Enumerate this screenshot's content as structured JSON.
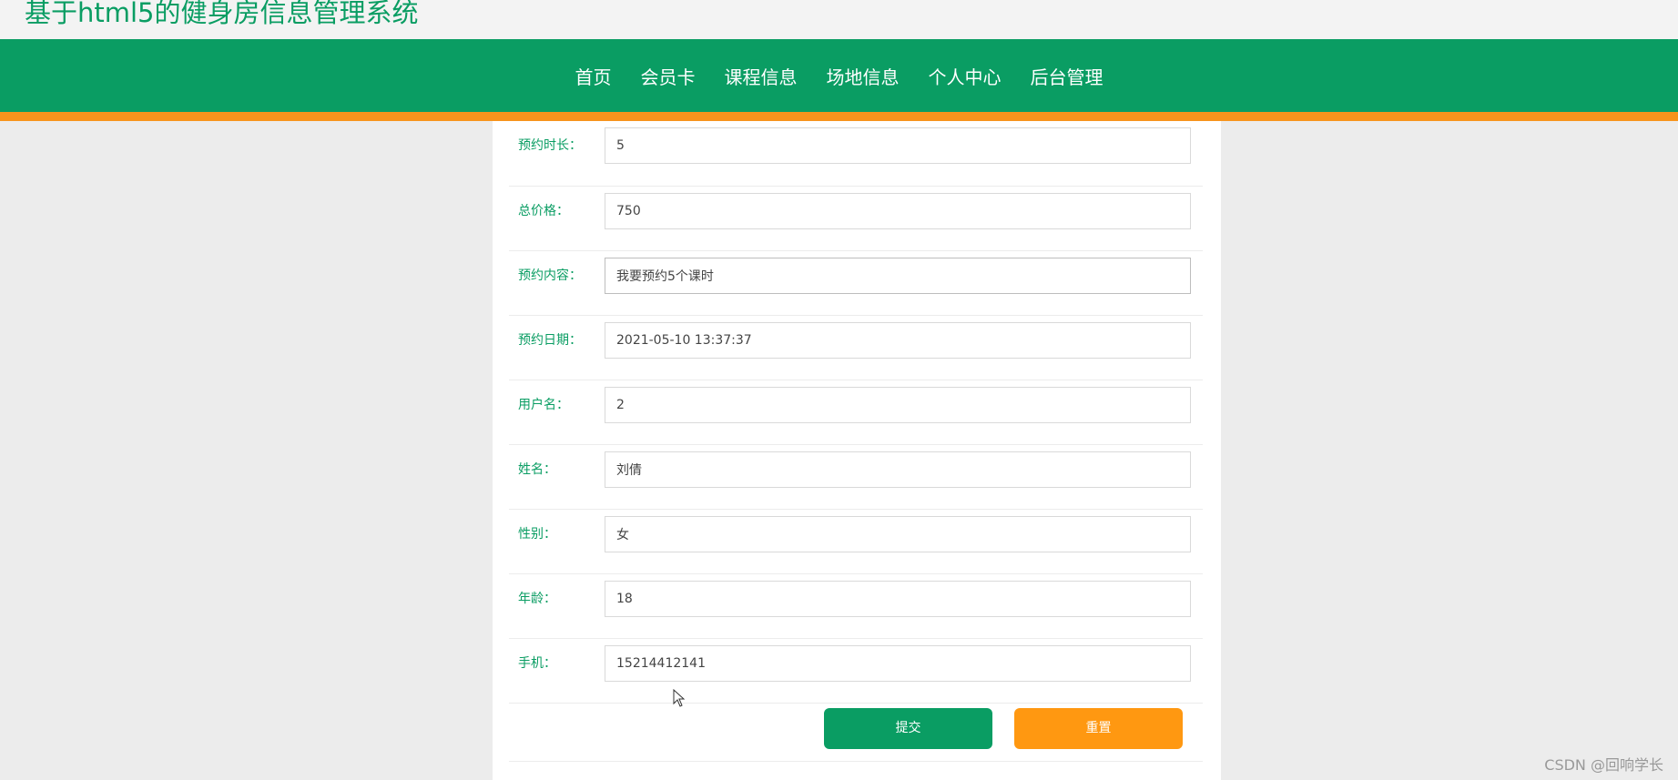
{
  "site_title": "基于html5的健身房信息管理系统",
  "nav": [
    "首页",
    "会员卡",
    "课程信息",
    "场地信息",
    "个人中心",
    "后台管理"
  ],
  "form": {
    "rows": [
      {
        "label": "预约时长：",
        "value": "5"
      },
      {
        "label": "总价格：",
        "value": "750"
      },
      {
        "label": "预约内容：",
        "value": "我要预约5个课时"
      },
      {
        "label": "预约日期：",
        "value": "2021-05-10 13:37:37"
      },
      {
        "label": "用户名：",
        "value": "2"
      },
      {
        "label": "姓名：",
        "value": "刘倩"
      },
      {
        "label": "性别：",
        "value": "女"
      },
      {
        "label": "年龄：",
        "value": "18"
      },
      {
        "label": "手机：",
        "value": "15214412141"
      }
    ],
    "submit_label": "提交",
    "reset_label": "重置"
  },
  "watermark": "CSDN @回响学长",
  "colors": {
    "brand_green": "#0a9d63",
    "accent_orange": "#f7941d",
    "reset_orange": "#ff9811"
  }
}
